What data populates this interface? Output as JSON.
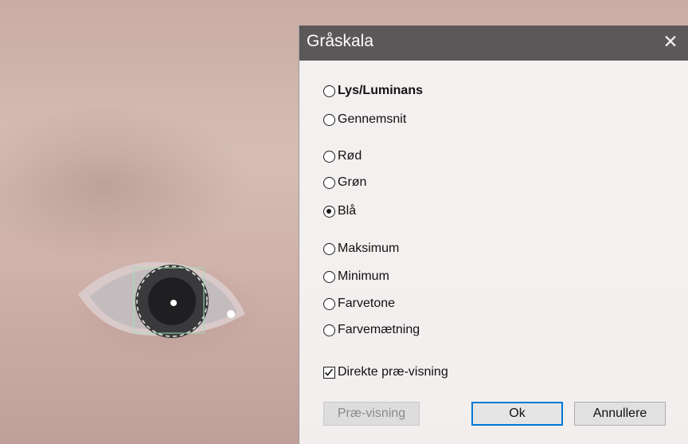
{
  "dialog": {
    "title": "Gråskala",
    "close_glyph": "✕",
    "options": [
      {
        "label": "Lys/Luminans",
        "selected": false,
        "bold": true
      },
      {
        "label": "Gennemsnit",
        "selected": false
      },
      {
        "label": "Rød",
        "selected": false
      },
      {
        "label": "Grøn",
        "selected": false
      },
      {
        "label": "Blå",
        "selected": true
      },
      {
        "label": "Maksimum",
        "selected": false
      },
      {
        "label": "Minimum",
        "selected": false
      },
      {
        "label": "Farvetone",
        "selected": false
      },
      {
        "label": "Farvemætning",
        "selected": false
      }
    ],
    "live_preview": {
      "label": "Direkte præ-visning",
      "checked": true
    },
    "buttons": {
      "preview": "Præ-visning",
      "ok": "Ok",
      "cancel": "Annullere"
    }
  }
}
